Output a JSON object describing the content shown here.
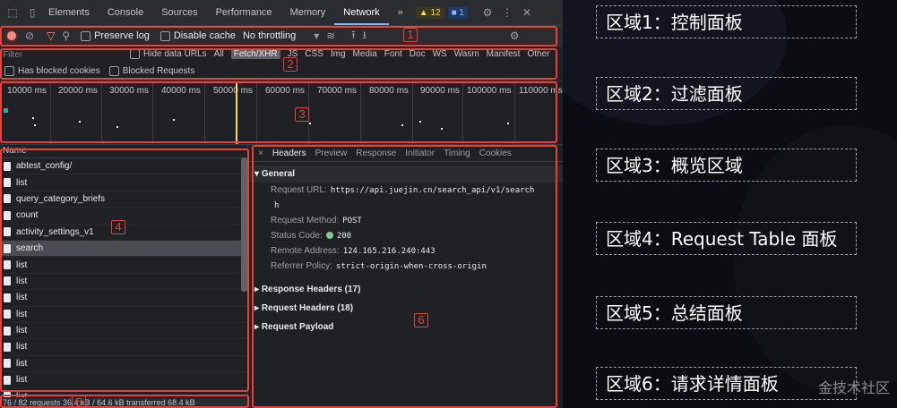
{
  "devtools": {
    "tabs": [
      "Elements",
      "Console",
      "Sources",
      "Performance",
      "Memory",
      "Network"
    ],
    "more": "»",
    "warn_count": "12",
    "info_count": "1",
    "toolbar": {
      "preserve_log": "Preserve log",
      "disable_cache": "Disable cache",
      "throttling": "No throttling"
    },
    "filter": {
      "placeholder": "Filter",
      "hide_data_urls": "Hide data URLs",
      "types": [
        "All",
        "Fetch/XHR",
        "JS",
        "CSS",
        "Img",
        "Media",
        "Font",
        "Doc",
        "WS",
        "Wasm",
        "Manifest",
        "Other"
      ],
      "has_blocked_cookies": "Has blocked cookies",
      "blocked_requests": "Blocked Requests"
    },
    "overview": {
      "ticks": [
        "10000 ms",
        "20000 ms",
        "30000 ms",
        "40000 ms",
        "50000 ms",
        "60000 ms",
        "70000 ms",
        "80000 ms",
        "90000 ms",
        "100000 ms",
        "110000 ms"
      ]
    },
    "requests": {
      "column": "Name",
      "items": [
        "abtest_config/",
        "list",
        "query_category_briefs",
        "count",
        "activity_settings_v1",
        "search",
        "list",
        "list",
        "list",
        "list",
        "list",
        "list",
        "list",
        "list",
        "list"
      ],
      "selected": "search"
    },
    "details": {
      "tabs": [
        "Headers",
        "Preview",
        "Response",
        "Initiator",
        "Timing",
        "Cookies"
      ],
      "general": "General",
      "fields": [
        {
          "k": "Request URL:",
          "v": "https://api.juejin.cn/search_api/v1/search"
        },
        {
          "k": "",
          "v": "h"
        },
        {
          "k": "Request Method:",
          "v": "POST"
        },
        {
          "k": "Status Code:",
          "v": "200"
        },
        {
          "k": "Remote Address:",
          "v": "124.165.216.240:443"
        },
        {
          "k": "Referrer Policy:",
          "v": "strict-origin-when-cross-origin"
        }
      ],
      "sections": [
        "Response Headers (17)",
        "Request Headers (18)",
        "Request Payload"
      ]
    },
    "status": "76 / 82 requests   36.4 kB / 64.6 kB transferred   68.4 kB"
  },
  "callouts": [
    "1",
    "2",
    "3",
    "4",
    "5",
    "6"
  ],
  "legend": [
    "区域1：控制面板",
    "区域2：过滤面板",
    "区域3：概览区域",
    "区域4：Request Table 面板",
    "区域5：总结面板",
    "区域6：请求详情面板"
  ],
  "watermark": "金技术社区"
}
